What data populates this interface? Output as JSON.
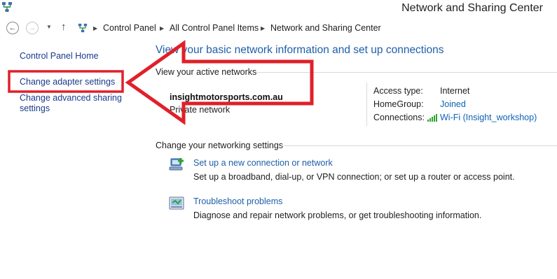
{
  "window": {
    "title": "Network and Sharing Center"
  },
  "nav": {
    "back_icon": "back-arrow-icon",
    "forward_icon": "forward-arrow-icon",
    "breadcrumb": [
      "Control Panel",
      "All Control Panel Items",
      "Network and Sharing Center"
    ]
  },
  "sidebar": {
    "home": "Control Panel Home",
    "adapter": "Change adapter settings",
    "advanced_line1": "Change advanced sharing",
    "advanced_line2": "settings"
  },
  "main": {
    "heading": "View your basic network information and set up connections",
    "active_label": "View your active networks",
    "network": {
      "name": "insightmotorsports.com.au",
      "type": "Private network",
      "access_type_label": "Access type:",
      "access_type": "Internet",
      "homegroup_label": "HomeGroup:",
      "homegroup": "Joined",
      "connections_label": "Connections:",
      "connection": "Wi-Fi (Insight_workshop)"
    },
    "settings_label": "Change your networking settings",
    "tasks": [
      {
        "title": "Set up a new connection or network",
        "desc": "Set up a broadband, dial-up, or VPN connection; or set up a router or access point.",
        "icon": "network-setup-icon"
      },
      {
        "title": "Troubleshoot problems",
        "desc": "Diagnose and repair network problems, or get troubleshooting information.",
        "icon": "troubleshoot-icon"
      }
    ]
  },
  "annotation": {
    "color": "#e0202a"
  }
}
